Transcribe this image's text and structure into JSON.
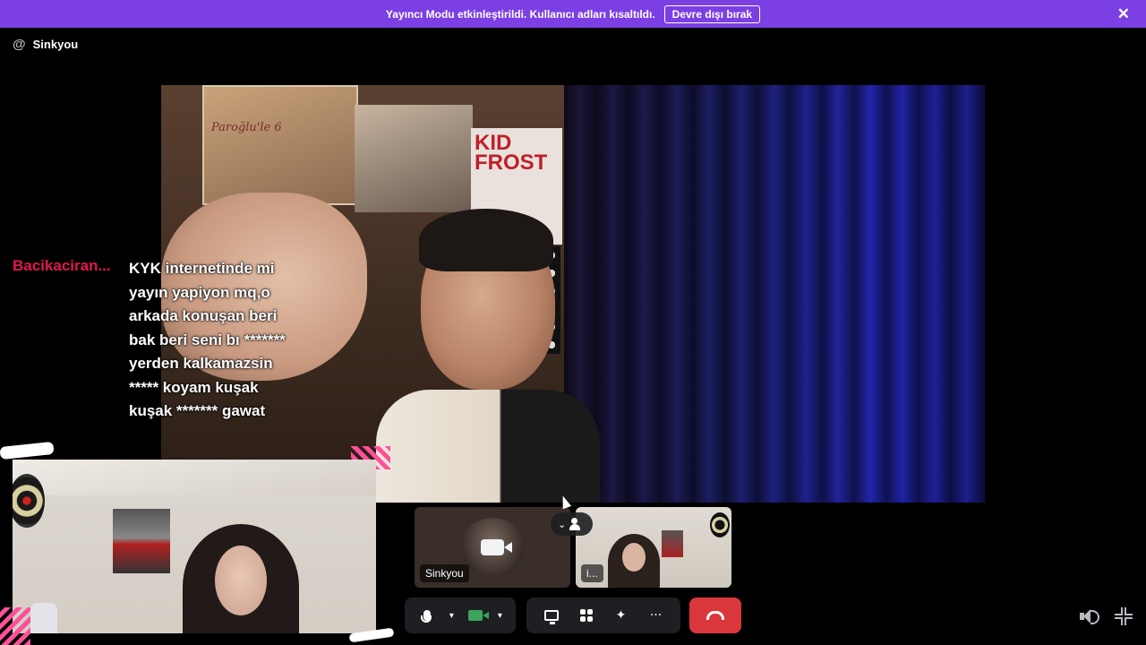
{
  "banner": {
    "message": "Yayıncı Modu etkinleştirildi. Kullanıcı adları kısaltıldı.",
    "disable_label": "Devre dışı bırak",
    "close_icon": "close-icon"
  },
  "channel": {
    "icon": "at-icon",
    "icon_glyph": "@",
    "name": "Sinkyou"
  },
  "main_video": {
    "poster_text": "Paroğlu'le 6",
    "poster3_text": "KID FROST"
  },
  "chat": {
    "username": "Bacikaciran...",
    "username_color": "#e0184d",
    "message_lines": [
      "KYK internetinde mi",
      "yayın yapiyon mq,o",
      "arkada konuşan beri",
      "bak beri seni bı *******",
      "yerden kalkamazsin",
      "***** koyam kuşak",
      "kuşak ******* gawat"
    ]
  },
  "tiles": {
    "self_name": "Sinkyou",
    "other_name": "i..."
  },
  "controls": {
    "mute_icon": "microphone-icon",
    "camera_icon": "video-camera-icon",
    "screen_share_icon": "screen-share-icon",
    "activities_icon": "activities-icon",
    "soundboard_icon": "soundboard-icon",
    "more_label": "···",
    "end_call_icon": "hang-up-icon",
    "end_call_color": "#da373c",
    "volume_icon": "volume-icon",
    "exit_fullscreen_icon": "exit-fullscreen-icon"
  },
  "colors": {
    "banner_bg": "#7b3fe4",
    "camera_on": "#3ba55d"
  }
}
